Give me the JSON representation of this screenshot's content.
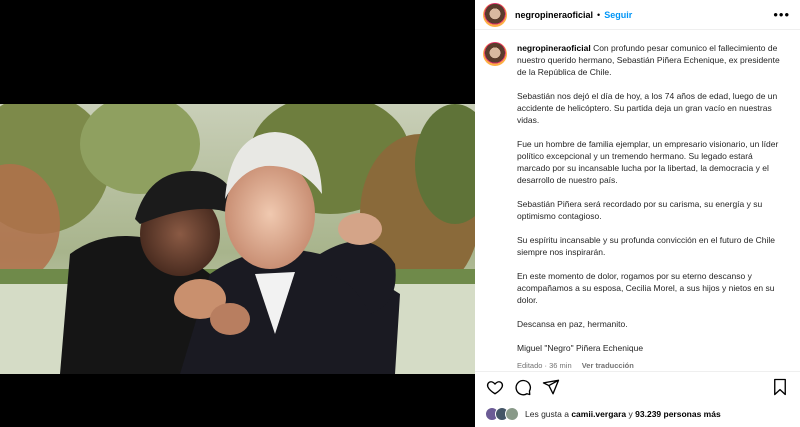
{
  "header": {
    "username": "negropineraoficial",
    "separator": "•",
    "follow_label": "Seguir",
    "more_label": "•••"
  },
  "caption": {
    "username": "negropineraoficial",
    "paragraphs": [
      "Con profundo pesar comunico el fallecimiento de nuestro querido hermano, Sebastián Piñera Echenique, ex presidente de la República de Chile.",
      "Sebastián nos dejó el día de hoy, a los 74 años de edad, luego de un accidente de helicóptero. Su partida deja un gran vacío en nuestras vidas.",
      "Fue un hombre de familia ejemplar, un empresario visionario, un líder político excepcional y un tremendo hermano. Su legado estará marcado por su incansable lucha por la libertad, la democracia y el desarrollo de nuestro país.",
      "Sebastián Piñera será recordado por su carisma, su energía y su optimismo contagioso.",
      "Su espíritu incansable y su profunda convicción en el futuro de Chile siempre nos inspirarán.",
      "En este momento de dolor, rogamos por su eterno descanso y acompañamos a su esposa, Cecilia Morel, a sus hijos y nietos en su dolor.",
      "Descansa en paz, hermanito.",
      "Miguel \"Negro\" Piñera Echenique"
    ],
    "edited": "Editado · 36 min",
    "translate": "Ver traducción"
  },
  "likes": {
    "prefix": "Les gusta a",
    "user": "camii.vergara",
    "middle": "y",
    "count": "93.239 personas más"
  },
  "icons": [
    "heart-icon",
    "comment-icon",
    "share-icon",
    "bookmark-icon",
    "more-icon"
  ]
}
